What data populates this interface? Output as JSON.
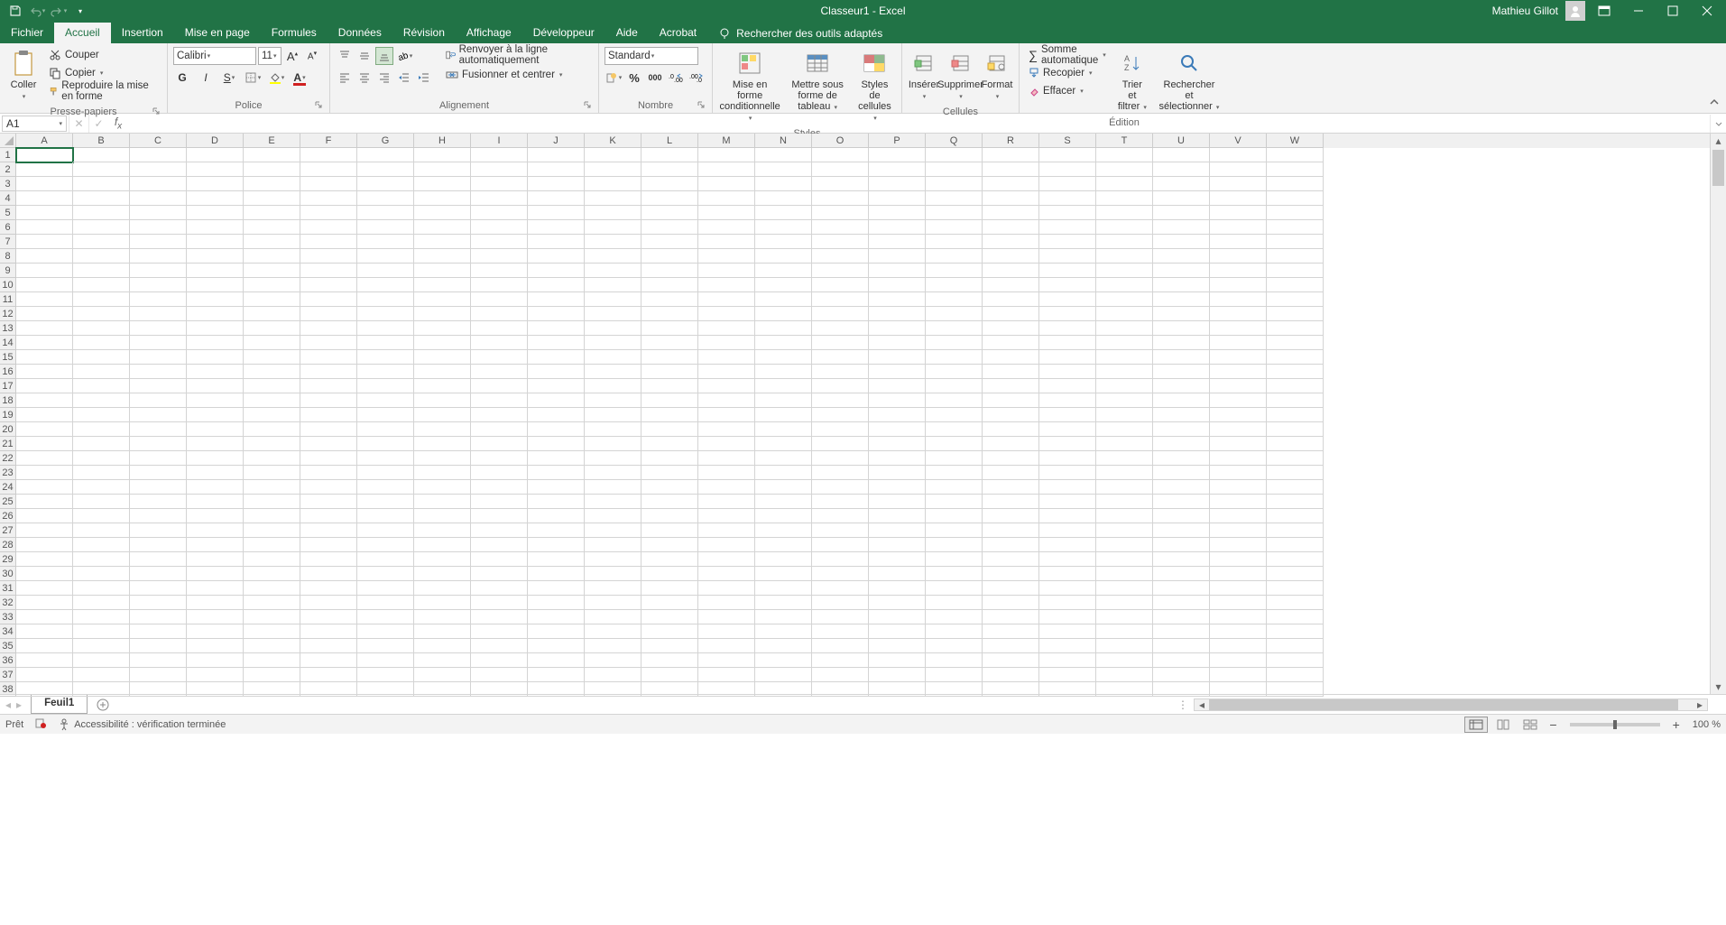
{
  "title": "Classeur1  -  Excel",
  "user": "Mathieu Gillot",
  "tabs": [
    "Fichier",
    "Accueil",
    "Insertion",
    "Mise en page",
    "Formules",
    "Données",
    "Révision",
    "Affichage",
    "Développeur",
    "Aide",
    "Acrobat"
  ],
  "active_tab": 1,
  "search_placeholder": "Rechercher des outils adaptés",
  "clipboard": {
    "paste": "Coller",
    "cut": "Couper",
    "copy": "Copier",
    "format_painter": "Reproduire la mise en forme",
    "label": "Presse-papiers"
  },
  "font": {
    "name": "Calibri",
    "size": "11",
    "label": "Police"
  },
  "alignment": {
    "wrap": "Renvoyer à la ligne automatiquement",
    "merge": "Fusionner et centrer",
    "label": "Alignement"
  },
  "number": {
    "format": "Standard",
    "label": "Nombre"
  },
  "styles": {
    "cond": "Mise en forme conditionnelle",
    "table": "Mettre sous forme de tableau",
    "cell": "Styles de cellules",
    "label": "Styles"
  },
  "cells": {
    "insert": "Insérer",
    "delete": "Supprimer",
    "format": "Format",
    "label": "Cellules"
  },
  "editing": {
    "sum": "Somme automatique",
    "fill": "Recopier",
    "clear": "Effacer",
    "sort": "Trier et filtrer",
    "find": "Rechercher et sélectionner",
    "label": "Édition"
  },
  "name_box": "A1",
  "columns": [
    "A",
    "B",
    "C",
    "D",
    "E",
    "F",
    "G",
    "H",
    "I",
    "J",
    "K",
    "L",
    "M",
    "N",
    "O",
    "P",
    "Q",
    "R",
    "S",
    "T",
    "U",
    "V",
    "W"
  ],
  "row_count": 38,
  "sheet_tab": "Feuil1",
  "status": {
    "ready": "Prêt",
    "accessibility": "Accessibilité : vérification terminée",
    "zoom": "100 %"
  },
  "icon_000": "000"
}
